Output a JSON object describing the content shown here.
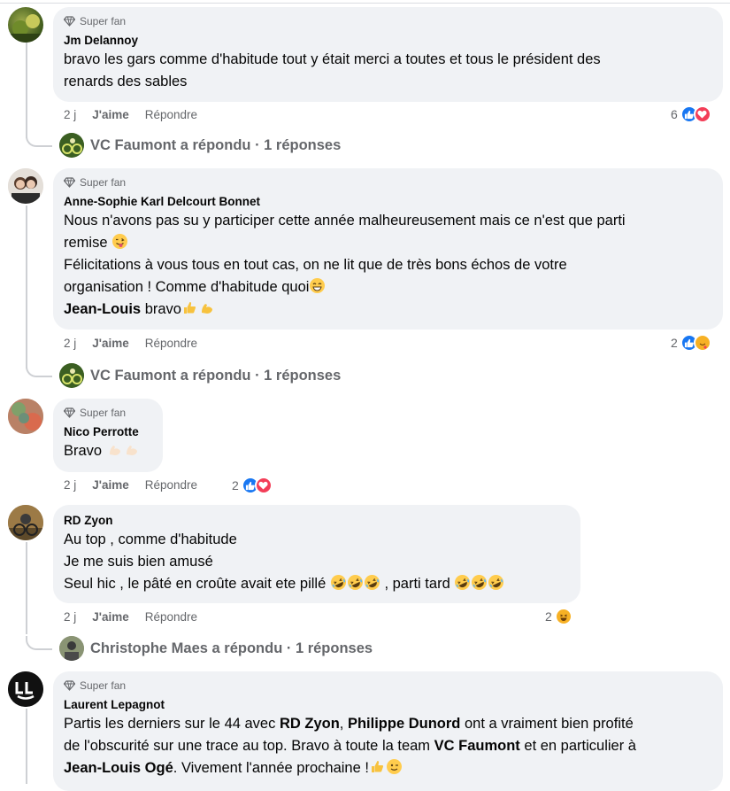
{
  "comments": [
    {
      "badge": "Super fan",
      "author": "Jm Delannoy",
      "lines": [
        "bravo les gars comme d'habitude tout y était merci a toutes et tous le président des",
        "renards des sables"
      ],
      "time": "2 j",
      "like": "J'aime",
      "reply": "Répondre",
      "react_count": "6",
      "thread": "VC Faumont a répondu · 1 réponses"
    },
    {
      "badge": "Super fan",
      "author": "Anne-Sophie Karl Delcourt Bonnet",
      "line1": "Nous n'avons pas su y participer cette année malheureusement mais ce n'est que parti",
      "line2": "remise",
      "line3": "Félicitations à vous tous en tout cas, on ne lit que de très bons échos de votre",
      "line4": "organisation ! Comme d'habitude quoi",
      "mention": "Jean-Louis",
      "line5": " bravo",
      "time": "2 j",
      "like": "J'aime",
      "reply": "Répondre",
      "react_count": "2",
      "thread": "VC Faumont a répondu · 1 réponses"
    },
    {
      "badge": "Super fan",
      "author": "Nico Perrotte",
      "text": "Bravo",
      "time": "2 j",
      "like": "J'aime",
      "reply": "Répondre",
      "react_count": "2"
    },
    {
      "author": "RD Zyon",
      "line1": "Au top , comme d'habitude",
      "line2": "Je me suis bien amusé",
      "line3a": "Seul hic , le pâté en croûte avait ete pillé",
      "line3b": " , parti tard",
      "time": "2 j",
      "like": "J'aime",
      "reply": "Répondre",
      "react_count": "2",
      "thread": "Christophe Maes a répondu · 1 réponses"
    },
    {
      "badge": "Super fan",
      "author": "Laurent Lepagnot",
      "p1": "Partis les derniers sur le 44 avec ",
      "m1": "RD Zyon",
      "p2": ", ",
      "m2": "Philippe Dunord",
      "p3": " ont a vraiment bien profité",
      "p4": "de l'obscurité sur une trace au top. Bravo à toute la team ",
      "m3": "VC Faumont",
      "p5": " et en particulier à",
      "m4": "Jean-Louis Ogé",
      "p6": ". Vivement l'année prochaine !"
    }
  ],
  "icons": {
    "badge": "diamond-icon",
    "like_reaction": "thumbs-up-icon",
    "love_reaction": "heart-icon",
    "haha_reaction": "laughing-face-icon",
    "care_reaction": "hug-face-icon"
  },
  "colors": {
    "bubble": "#f0f2f5",
    "like_blue": "#1877f2",
    "love_red": "#f33e58",
    "muted": "#65676b"
  }
}
